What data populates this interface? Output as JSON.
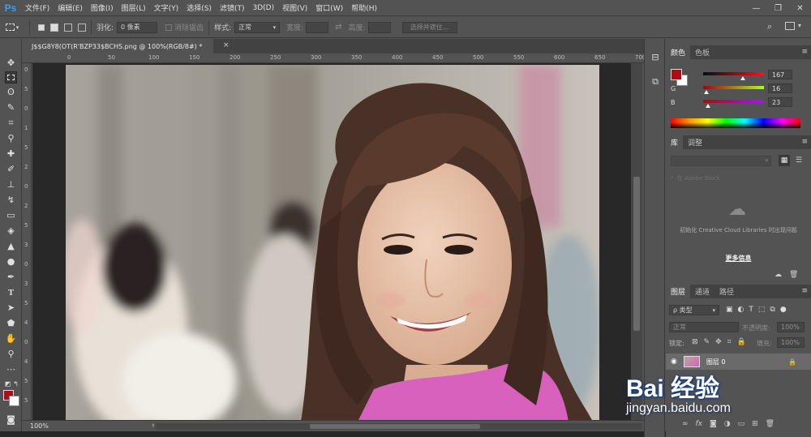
{
  "app": {
    "logo": "Ps"
  },
  "menu": [
    "文件(F)",
    "编辑(E)",
    "图像(I)",
    "图层(L)",
    "文字(Y)",
    "选择(S)",
    "滤镜(T)",
    "3D(D)",
    "视图(V)",
    "窗口(W)",
    "帮助(H)"
  ],
  "window_controls": {
    "minimize": "—",
    "restore": "❐",
    "close": "✕"
  },
  "options_bar": {
    "feather_label": "羽化:",
    "feather_value": "0 像素",
    "antialias_label": "消除锯齿",
    "style_label": "样式:",
    "style_value": "正常",
    "width_label": "宽度:",
    "height_label": "高度:",
    "select_mask_button": "选择并遮住..."
  },
  "document_tab": {
    "title": "J$$G8Y8(OT(R'BZP33$BCHS.png @ 100%(RGB/8#) *",
    "close": "×"
  },
  "rulers": {
    "top_ticks": [
      "0",
      "50",
      "100",
      "150",
      "200",
      "250",
      "300",
      "350",
      "400",
      "450",
      "500",
      "550",
      "600",
      "650",
      "700"
    ],
    "left_ticks": [
      "0",
      "5",
      "0",
      "1",
      "5",
      "2",
      "0",
      "2",
      "5",
      "3",
      "0",
      "3",
      "5",
      "4",
      "0",
      "4",
      "5",
      "5"
    ]
  },
  "status": {
    "zoom": "100%"
  },
  "color_panel": {
    "tabs": [
      "颜色",
      "色板"
    ],
    "foreground_hex": "#a71017",
    "background_hex": "#ffffff",
    "channels": [
      {
        "name": "R",
        "value": "167"
      },
      {
        "name": "G",
        "value": "16"
      },
      {
        "name": "B",
        "value": "23"
      }
    ]
  },
  "library_panel": {
    "tabs": [
      "库",
      "调整"
    ],
    "search_placeholder": "在 Adobe Stock",
    "message": "初始化 Creative Cloud Libraries 时出现问题",
    "more_info": "更多信息"
  },
  "layers_panel": {
    "tabs": [
      "图层",
      "通道",
      "路径"
    ],
    "filter_kind": "ρ 类型",
    "blend_mode": "正常",
    "opacity_label": "不透明度:",
    "opacity_value": "100%",
    "lock_label": "锁定:",
    "fill_label": "填充:",
    "fill_value": "100%",
    "layers": [
      {
        "name": "图层 0",
        "visible": true,
        "locked": true
      }
    ],
    "footer_icons": [
      "link-icon",
      "fx-icon",
      "mask-icon",
      "adjustment-icon",
      "group-icon",
      "new-layer-icon",
      "trash-icon"
    ]
  },
  "watermark": {
    "brand": "Bai 经验",
    "url": "jingyan.baidu.com"
  }
}
